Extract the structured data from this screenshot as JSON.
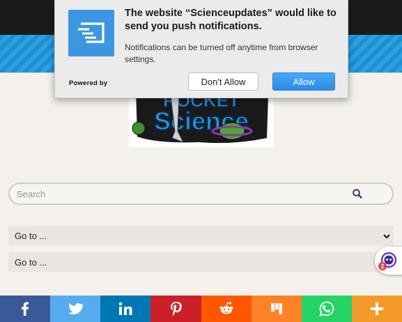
{
  "dialog": {
    "title": "The website “Scienceupdates” would like to send you push notifications.",
    "body": "Notifications can be turned off anytime from browser settings.",
    "powered_by": "Powered by",
    "deny_label": "Don't Allow",
    "allow_label": "Allow",
    "app_icon": "notification-icon",
    "accent": "#3d97e0"
  },
  "logo": {
    "text": "Science",
    "alt": "Rocket Science logo"
  },
  "search": {
    "placeholder": "Search",
    "icon": "search-icon"
  },
  "nav": {
    "goto_1": "Go to ...",
    "goto_2": "Go to ..."
  },
  "chat": {
    "badge": "2",
    "icon": "chat-bot-icon"
  },
  "share": [
    {
      "name": "facebook",
      "icon": "facebook-icon",
      "color": "#3b5998"
    },
    {
      "name": "twitter",
      "icon": "twitter-icon",
      "color": "#55acee"
    },
    {
      "name": "linkedin",
      "icon": "linkedin-icon",
      "color": "#0077b5"
    },
    {
      "name": "pinterest",
      "icon": "pinterest-icon",
      "color": "#cb2027"
    },
    {
      "name": "reddit",
      "icon": "reddit-icon",
      "color": "#ff5700"
    },
    {
      "name": "mix",
      "icon": "mix-icon",
      "color": "#ff8226"
    },
    {
      "name": "whatsapp",
      "icon": "whatsapp-icon",
      "color": "#25d366"
    },
    {
      "name": "more",
      "icon": "plus-icon",
      "color": "#f49a2a"
    }
  ]
}
